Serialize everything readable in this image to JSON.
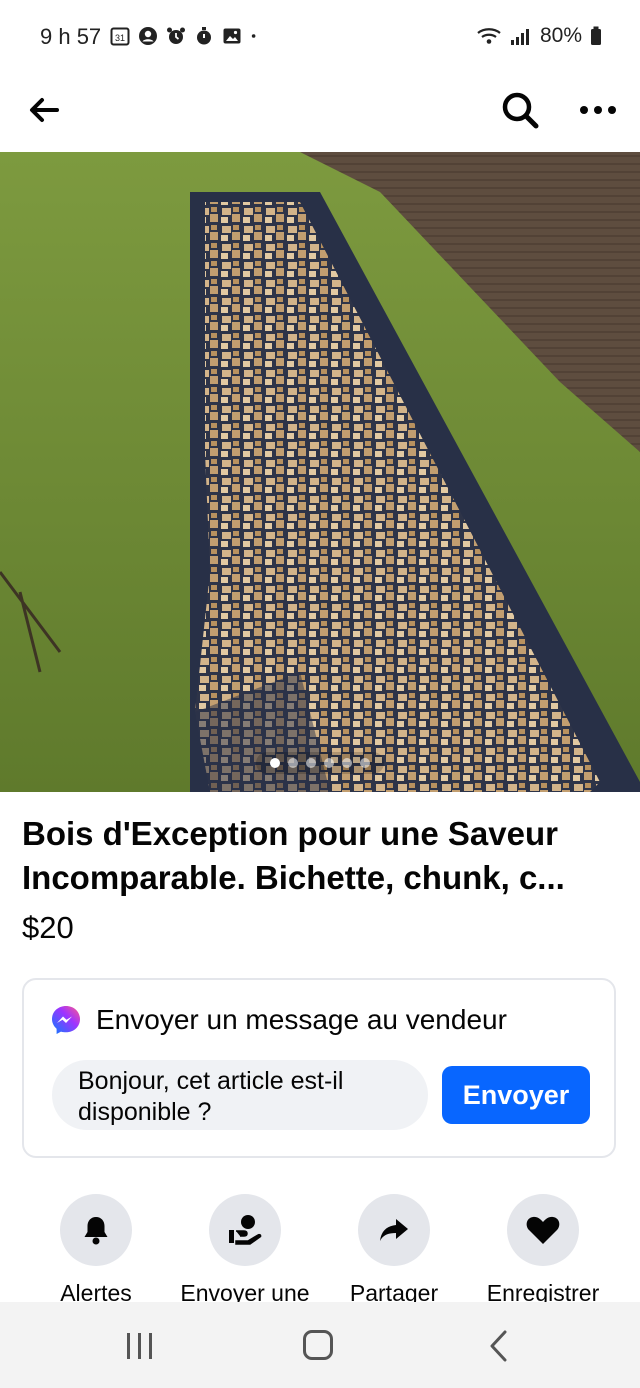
{
  "status_bar": {
    "time": "9 h 57",
    "calendar_day": "31",
    "battery": "80%",
    "icons": [
      "calendar-icon",
      "account-icon",
      "alarm-icon",
      "timer-icon",
      "gallery-icon",
      "dot-icon",
      "wifi-icon",
      "signal-icon",
      "battery-icon"
    ]
  },
  "nav": {
    "icons": [
      "back-arrow-icon",
      "search-icon",
      "more-icon"
    ]
  },
  "photo": {
    "slide_count": 6,
    "active_slide": 1
  },
  "listing": {
    "title": "Bois d'Exception pour une Saveur Incomparable. Bichette, chunk, c...",
    "price": "$20"
  },
  "message": {
    "header": "Envoyer un message au vendeur",
    "input_value": "Bonjour, cet article est-il disponible ?",
    "send_label": "Envoyer"
  },
  "actions": [
    {
      "label": "Alertes",
      "icon": "bell-icon"
    },
    {
      "label": "Envoyer une",
      "icon": "send-offer-icon"
    },
    {
      "label": "Partager",
      "icon": "share-icon"
    },
    {
      "label": "Enregistrer",
      "icon": "heart-icon"
    }
  ],
  "colors": {
    "accent": "#0866ff",
    "circle_bg": "#e4e6eb",
    "input_bg": "#f0f2f5"
  }
}
